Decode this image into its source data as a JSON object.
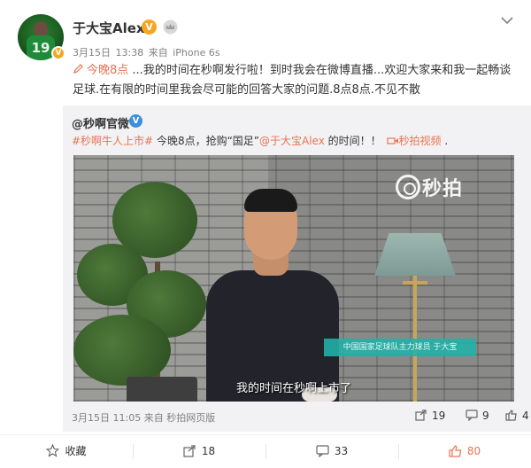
{
  "post": {
    "username": "于大宝Alex",
    "date": "3月15日",
    "time": "13:38",
    "source_prefix": "来自",
    "source": "iPhone 6s",
    "text_link": "今晚8点",
    "text_body": "...我的时间在秒啊发行啦！到时我会在微博直播...欢迎大家来和我一起畅谈足球.在有限的时间里我会尽可能的回答大家的问题.8点8点.不见不散"
  },
  "repost": {
    "author": "@秒啊官微",
    "hashtag": "#秒啊牛人上市#",
    "text_1": " 今晚8点，抢购“国足”",
    "mention": "@于大宝Alex",
    "text_2": " 的时间！！",
    "video_link": "秒拍视频",
    "text_3": " .",
    "video": {
      "watermark": "秒拍",
      "nameplate": "中国国家足球队主力球员  于大宝",
      "subtitle": "我的时间在秒啊上市了"
    },
    "meta_date": "3月15日",
    "meta_time": "11:05",
    "meta_source": "来自 秒拍网页版",
    "forward_count": "19",
    "comment_count": "9",
    "like_count": "4"
  },
  "actions": {
    "favorite_label": "收藏",
    "forward_count": "18",
    "comment_count": "33",
    "like_count": "80"
  },
  "colors": {
    "link": "#eb7350",
    "verified_gold": "#f5a623",
    "verified_blue": "#3d8fdb",
    "repost_bg": "#f2f2f5"
  },
  "icons": {
    "avatar_badge": "verified-badge-icon",
    "more": "chevron-down-icon",
    "crown": "vip-crown-icon",
    "favorite": "star-icon",
    "forward": "forward-icon",
    "comment": "comment-icon",
    "like": "thumbs-up-icon",
    "edit": "pencil-icon",
    "video": "video-camera-icon"
  }
}
